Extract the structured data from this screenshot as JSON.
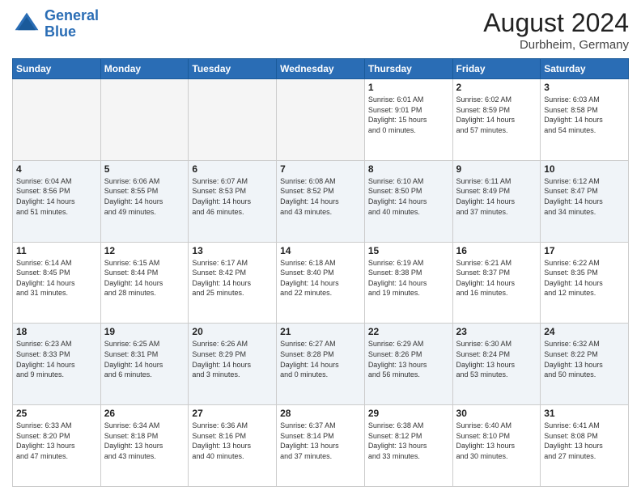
{
  "header": {
    "logo_line1": "General",
    "logo_line2": "Blue",
    "month": "August 2024",
    "location": "Durbheim, Germany"
  },
  "days_of_week": [
    "Sunday",
    "Monday",
    "Tuesday",
    "Wednesday",
    "Thursday",
    "Friday",
    "Saturday"
  ],
  "weeks": [
    [
      {
        "day": "",
        "info": ""
      },
      {
        "day": "",
        "info": ""
      },
      {
        "day": "",
        "info": ""
      },
      {
        "day": "",
        "info": ""
      },
      {
        "day": "1",
        "info": "Sunrise: 6:01 AM\nSunset: 9:01 PM\nDaylight: 15 hours\nand 0 minutes."
      },
      {
        "day": "2",
        "info": "Sunrise: 6:02 AM\nSunset: 8:59 PM\nDaylight: 14 hours\nand 57 minutes."
      },
      {
        "day": "3",
        "info": "Sunrise: 6:03 AM\nSunset: 8:58 PM\nDaylight: 14 hours\nand 54 minutes."
      }
    ],
    [
      {
        "day": "4",
        "info": "Sunrise: 6:04 AM\nSunset: 8:56 PM\nDaylight: 14 hours\nand 51 minutes."
      },
      {
        "day": "5",
        "info": "Sunrise: 6:06 AM\nSunset: 8:55 PM\nDaylight: 14 hours\nand 49 minutes."
      },
      {
        "day": "6",
        "info": "Sunrise: 6:07 AM\nSunset: 8:53 PM\nDaylight: 14 hours\nand 46 minutes."
      },
      {
        "day": "7",
        "info": "Sunrise: 6:08 AM\nSunset: 8:52 PM\nDaylight: 14 hours\nand 43 minutes."
      },
      {
        "day": "8",
        "info": "Sunrise: 6:10 AM\nSunset: 8:50 PM\nDaylight: 14 hours\nand 40 minutes."
      },
      {
        "day": "9",
        "info": "Sunrise: 6:11 AM\nSunset: 8:49 PM\nDaylight: 14 hours\nand 37 minutes."
      },
      {
        "day": "10",
        "info": "Sunrise: 6:12 AM\nSunset: 8:47 PM\nDaylight: 14 hours\nand 34 minutes."
      }
    ],
    [
      {
        "day": "11",
        "info": "Sunrise: 6:14 AM\nSunset: 8:45 PM\nDaylight: 14 hours\nand 31 minutes."
      },
      {
        "day": "12",
        "info": "Sunrise: 6:15 AM\nSunset: 8:44 PM\nDaylight: 14 hours\nand 28 minutes."
      },
      {
        "day": "13",
        "info": "Sunrise: 6:17 AM\nSunset: 8:42 PM\nDaylight: 14 hours\nand 25 minutes."
      },
      {
        "day": "14",
        "info": "Sunrise: 6:18 AM\nSunset: 8:40 PM\nDaylight: 14 hours\nand 22 minutes."
      },
      {
        "day": "15",
        "info": "Sunrise: 6:19 AM\nSunset: 8:38 PM\nDaylight: 14 hours\nand 19 minutes."
      },
      {
        "day": "16",
        "info": "Sunrise: 6:21 AM\nSunset: 8:37 PM\nDaylight: 14 hours\nand 16 minutes."
      },
      {
        "day": "17",
        "info": "Sunrise: 6:22 AM\nSunset: 8:35 PM\nDaylight: 14 hours\nand 12 minutes."
      }
    ],
    [
      {
        "day": "18",
        "info": "Sunrise: 6:23 AM\nSunset: 8:33 PM\nDaylight: 14 hours\nand 9 minutes."
      },
      {
        "day": "19",
        "info": "Sunrise: 6:25 AM\nSunset: 8:31 PM\nDaylight: 14 hours\nand 6 minutes."
      },
      {
        "day": "20",
        "info": "Sunrise: 6:26 AM\nSunset: 8:29 PM\nDaylight: 14 hours\nand 3 minutes."
      },
      {
        "day": "21",
        "info": "Sunrise: 6:27 AM\nSunset: 8:28 PM\nDaylight: 14 hours\nand 0 minutes."
      },
      {
        "day": "22",
        "info": "Sunrise: 6:29 AM\nSunset: 8:26 PM\nDaylight: 13 hours\nand 56 minutes."
      },
      {
        "day": "23",
        "info": "Sunrise: 6:30 AM\nSunset: 8:24 PM\nDaylight: 13 hours\nand 53 minutes."
      },
      {
        "day": "24",
        "info": "Sunrise: 6:32 AM\nSunset: 8:22 PM\nDaylight: 13 hours\nand 50 minutes."
      }
    ],
    [
      {
        "day": "25",
        "info": "Sunrise: 6:33 AM\nSunset: 8:20 PM\nDaylight: 13 hours\nand 47 minutes."
      },
      {
        "day": "26",
        "info": "Sunrise: 6:34 AM\nSunset: 8:18 PM\nDaylight: 13 hours\nand 43 minutes."
      },
      {
        "day": "27",
        "info": "Sunrise: 6:36 AM\nSunset: 8:16 PM\nDaylight: 13 hours\nand 40 minutes."
      },
      {
        "day": "28",
        "info": "Sunrise: 6:37 AM\nSunset: 8:14 PM\nDaylight: 13 hours\nand 37 minutes."
      },
      {
        "day": "29",
        "info": "Sunrise: 6:38 AM\nSunset: 8:12 PM\nDaylight: 13 hours\nand 33 minutes."
      },
      {
        "day": "30",
        "info": "Sunrise: 6:40 AM\nSunset: 8:10 PM\nDaylight: 13 hours\nand 30 minutes."
      },
      {
        "day": "31",
        "info": "Sunrise: 6:41 AM\nSunset: 8:08 PM\nDaylight: 13 hours\nand 27 minutes."
      }
    ]
  ]
}
